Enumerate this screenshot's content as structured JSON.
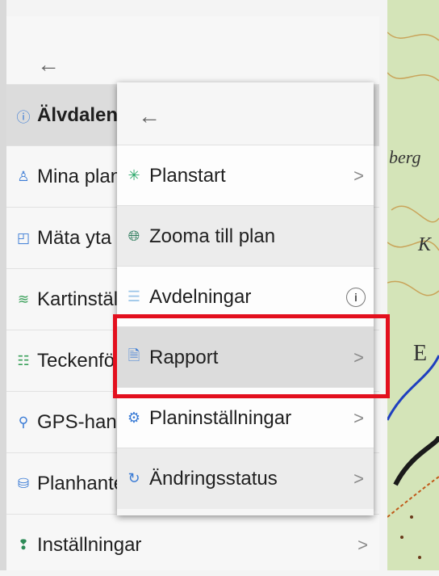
{
  "main_menu": {
    "back_icon": "arrow-left-icon",
    "items": [
      {
        "label": "Älvdalen",
        "icon": "info-circle-icon",
        "active": true
      },
      {
        "label": "Mina planer",
        "icon": "user-icon"
      },
      {
        "label": "Mäta yta",
        "icon": "measure-icon"
      },
      {
        "label": "Kartinställningar",
        "icon": "layers-icon"
      },
      {
        "label": "Teckenförklaring",
        "icon": "legend-icon"
      },
      {
        "label": "GPS-hantering",
        "icon": "location-pin-icon"
      },
      {
        "label": "Planhantering",
        "icon": "database-icon"
      },
      {
        "label": "Inställningar",
        "icon": "settings-pin-icon",
        "chevron": ">"
      }
    ]
  },
  "submenu": {
    "back_icon": "arrow-left-icon",
    "items": [
      {
        "label": "Planstart",
        "icon": "sparkle-icon",
        "chevron": ">"
      },
      {
        "label": "Zooma till plan",
        "icon": "globe-icon"
      },
      {
        "label": "Avdelningar",
        "icon": "list-icon",
        "info": "i"
      },
      {
        "label": "Rapport",
        "icon": "pdf-document-icon",
        "chevron": ">"
      },
      {
        "label": "Planinställningar",
        "icon": "gear-icon",
        "chevron": ">"
      },
      {
        "label": "Ändringsstatus",
        "icon": "refresh-icon",
        "chevron": ">"
      }
    ]
  },
  "map": {
    "labels": [
      "berg",
      "K",
      "E"
    ]
  },
  "colors": {
    "highlight": "#e3101e",
    "accent": "#3a7bd5"
  }
}
